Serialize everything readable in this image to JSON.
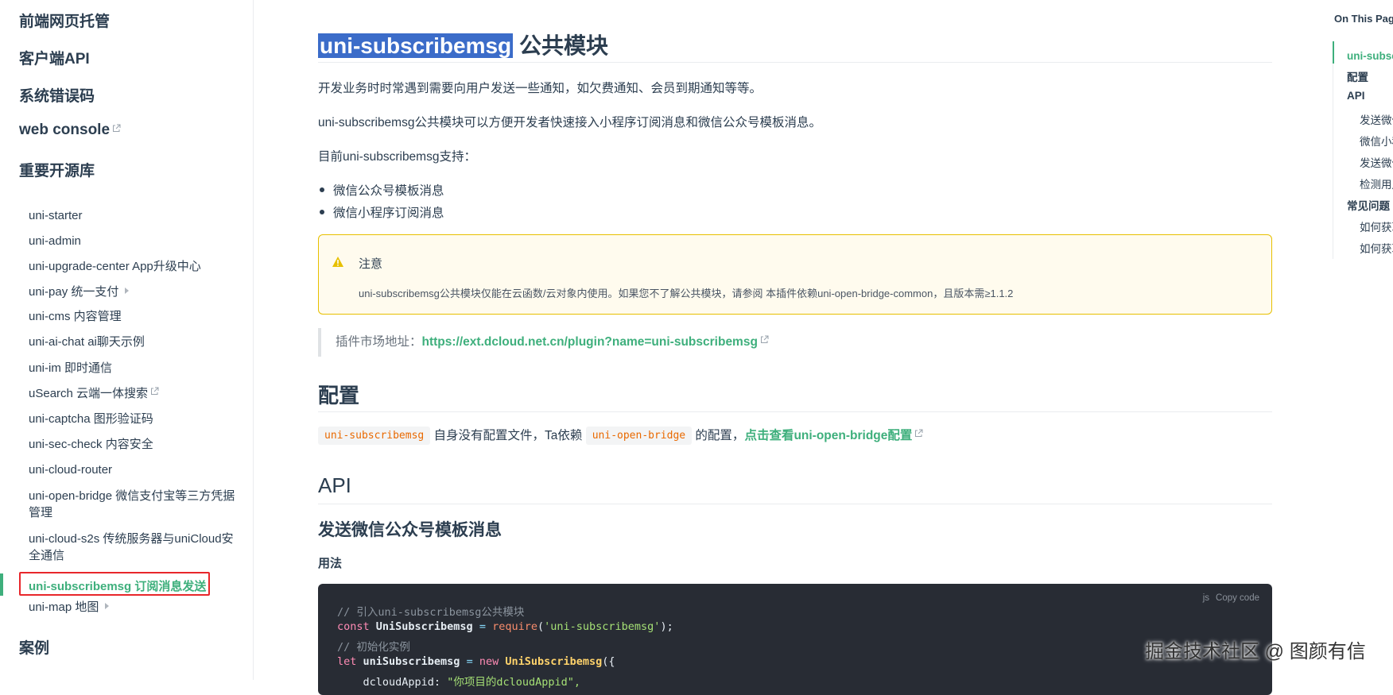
{
  "sidebar": {
    "headings": {
      "hosting": "前端网页托管",
      "client_api": "客户端API",
      "error_codes": "系统错误码",
      "web_console": "web console",
      "open_source": "重要开源库",
      "cases": "案例"
    },
    "items": [
      {
        "label": "uni-starter"
      },
      {
        "label": "uni-admin"
      },
      {
        "label": "uni-upgrade-center App升级中心"
      },
      {
        "label": "uni-pay 统一支付"
      },
      {
        "label": "uni-cms 内容管理"
      },
      {
        "label": "uni-ai-chat ai聊天示例"
      },
      {
        "label": "uni-im 即时通信"
      },
      {
        "label": "uSearch 云端一体搜索"
      },
      {
        "label": "uni-captcha 图形验证码"
      },
      {
        "label": "uni-sec-check 内容安全"
      },
      {
        "label": "uni-cloud-router"
      },
      {
        "label": "uni-open-bridge 微信支付宝等三方凭据管理"
      },
      {
        "label": "uni-cloud-s2s 传统服务器与uniCloud安全通信"
      },
      {
        "label": "uni-subscribemsg 订阅消息发送"
      },
      {
        "label": "uni-map 地图"
      }
    ]
  },
  "main": {
    "title_highlight": "uni-subscribemsg",
    "title_rest": " 公共模块",
    "para1": "开发业务时时常遇到需要向用户发送一些通知，如欠费通知、会员到期通知等等。",
    "para2": "uni-subscribemsg公共模块可以方便开发者快速接入小程序订阅消息和微信公众号模板消息。",
    "para3": "目前uni-subscribemsg支持：",
    "bullets": [
      "微信公众号模板消息",
      "微信小程序订阅消息"
    ],
    "notice": {
      "title": "注意",
      "text": "uni-subscribemsg公共模块仅能在云函数/云对象内使用。如果您不了解公共模块，请参阅 本插件依赖uni-open-bridge-common，且版本需≥1.1.2"
    },
    "market_label": "插件市场地址：",
    "market_link": "https://ext.dcloud.net.cn/plugin?name=uni-subscribemsg",
    "config_heading": "配置",
    "config_code1": "uni-subscribemsg",
    "config_text1": " 自身没有配置文件，Ta依赖 ",
    "config_code2": "uni-open-bridge",
    "config_text2": " 的配置，",
    "config_link": "点击查看uni-open-bridge配置",
    "api_heading": "API",
    "send_heading": "发送微信公众号模板消息",
    "usage_heading": "用法",
    "code": {
      "lang": "js",
      "copy_label": "Copy code",
      "line1_comment": "// 引入uni-subscribemsg公共模块",
      "line2_kw": "const",
      "line2_name": " UniSubscribemsg ",
      "line2_op": "=",
      "line2_fn": " require",
      "line2_open": "(",
      "line2_str": "'uni-subscribemsg'",
      "line2_close": ");",
      "line3_comment": "// 初始化实例",
      "line4_kw": "let",
      "line4_name": " uniSubscribemsg ",
      "line4_op": "=",
      "line4_kw2": " new",
      "line4_cls": " UniSubscribemsg",
      "line4_close": "({",
      "line5_key": "    dcloudAppid",
      "line5_sep": ": ",
      "line5_str": "\"你项目的dcloudAppid\","
    }
  },
  "toc": {
    "title": "On This Page",
    "items": [
      {
        "label": "uni-subscribemsg 公共模块"
      },
      {
        "label": "配置"
      },
      {
        "label": "API"
      },
      {
        "label": "发送微信公众号模板消息"
      },
      {
        "label": "微信小程序订阅消息"
      },
      {
        "label": "发送微信小程序订阅消息"
      },
      {
        "label": "检测用户是否关注"
      },
      {
        "label": "常见问题"
      },
      {
        "label": "如何获取模板"
      },
      {
        "label": "如何获取openid"
      }
    ]
  },
  "watermark": "掘金技术社区 @ 图颜有信",
  "colors": {
    "accent": "#3eaf7c",
    "highlight": "#3b6cc9",
    "notice_border": "#e7c000",
    "active_outline": "#e8262b"
  }
}
